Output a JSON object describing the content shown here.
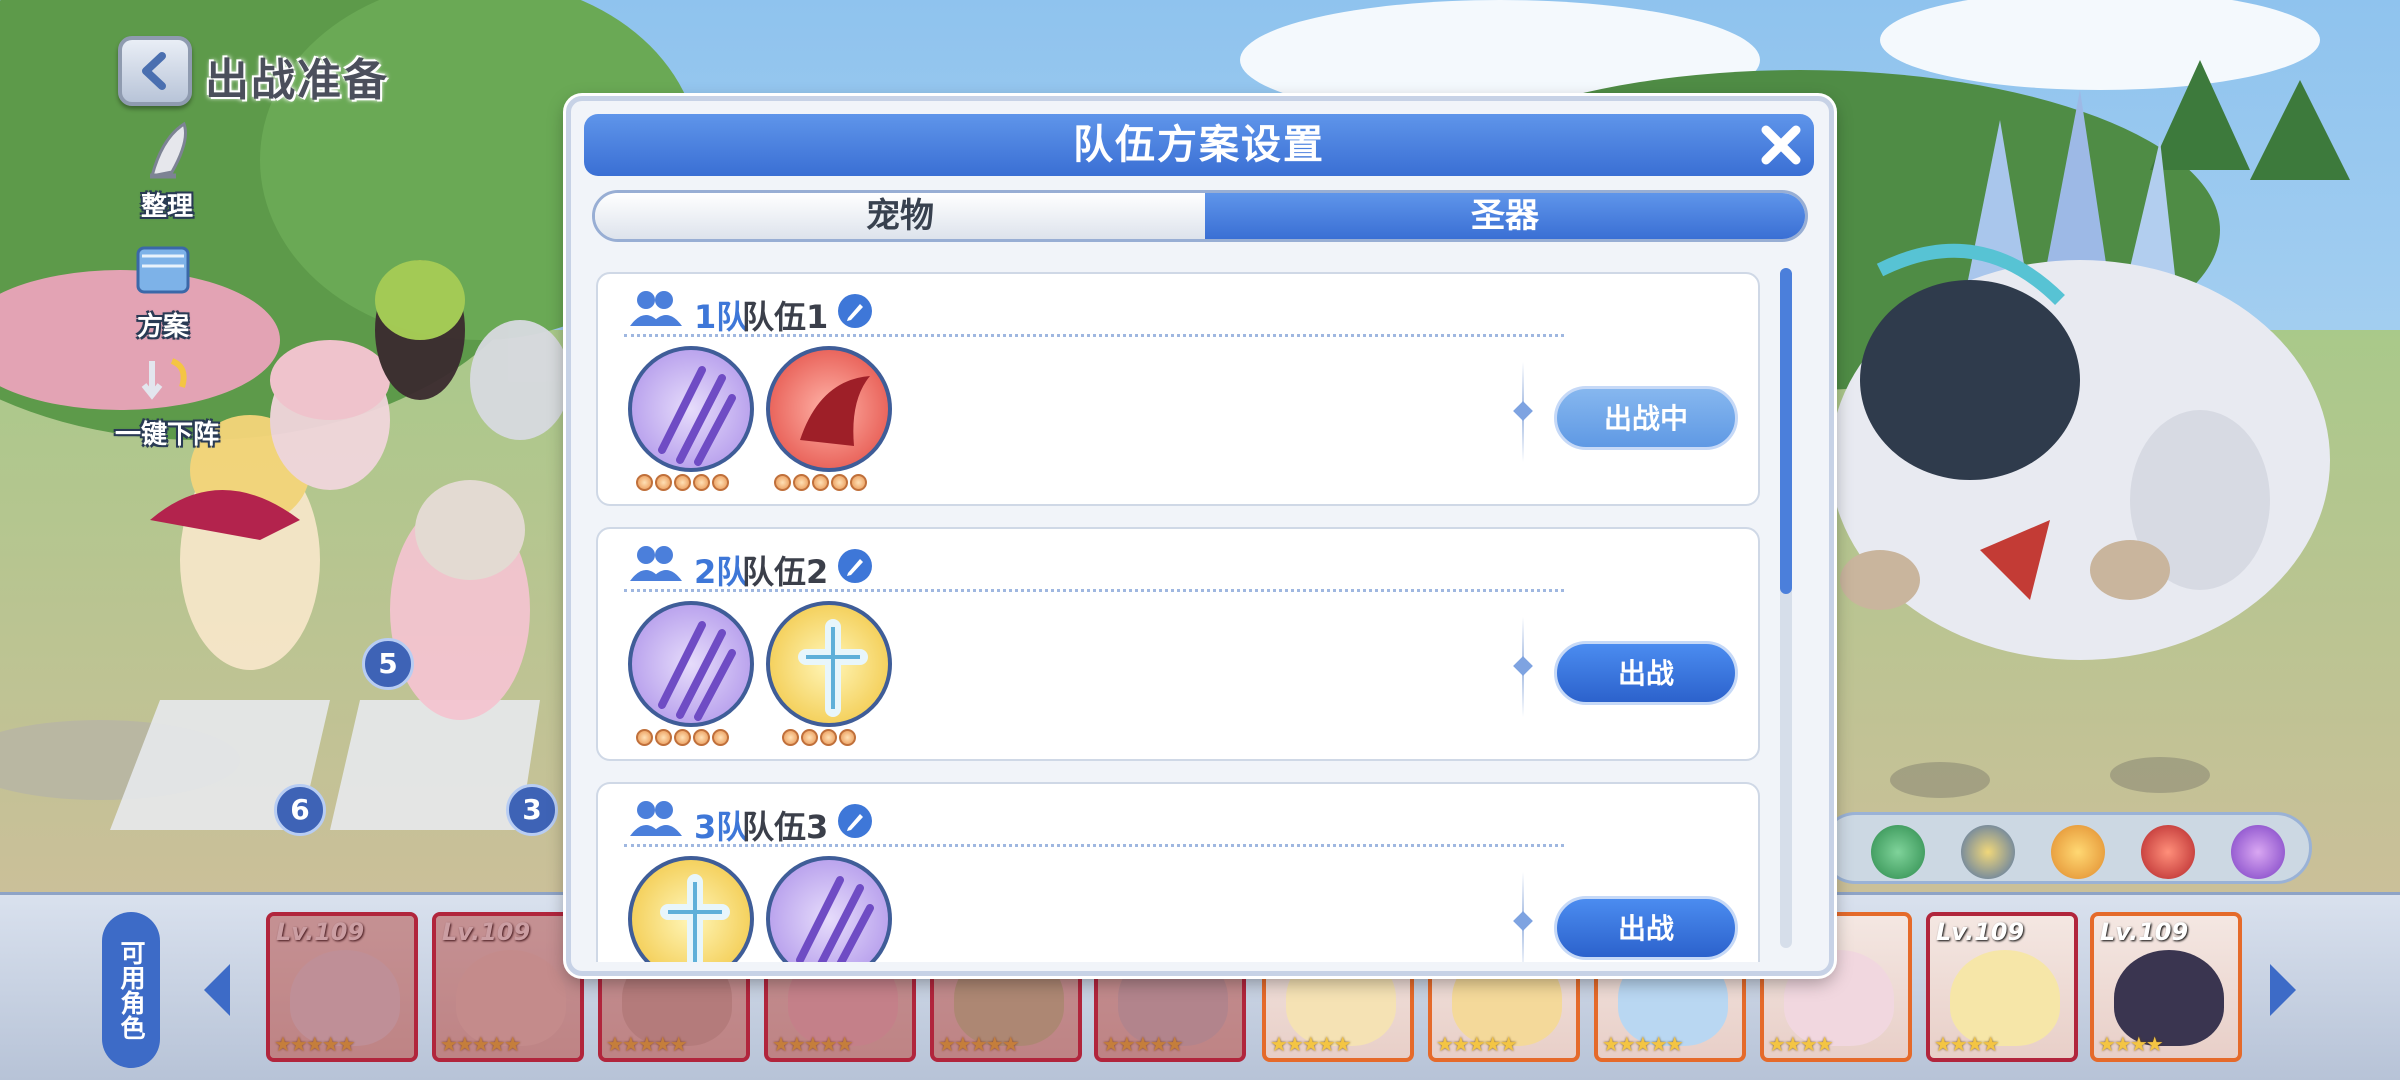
{
  "header": {
    "back_label": "",
    "page_title": "出战准备"
  },
  "side_tools": [
    {
      "label": "整理",
      "icon": "broom-icon"
    },
    {
      "label": "方案",
      "icon": "book-icon"
    },
    {
      "label": "一键下阵",
      "icon": "undeploy-icon"
    }
  ],
  "formation_slots": [
    "5",
    "6",
    "3"
  ],
  "modal": {
    "title": "队伍方案设置",
    "tabs": [
      {
        "label": "宠物",
        "selected": false
      },
      {
        "label": "圣器",
        "selected": true
      }
    ],
    "teams": [
      {
        "number": "1队",
        "name": "队伍1",
        "button": "出战中",
        "button_state": "active",
        "relics": [
          {
            "type": "purple-claw",
            "stars": 5
          },
          {
            "type": "red-wing",
            "stars": 5
          }
        ]
      },
      {
        "number": "2队",
        "name": "队伍2",
        "button": "出战",
        "button_state": "normal",
        "relics": [
          {
            "type": "purple-claw",
            "stars": 5
          },
          {
            "type": "gold-cross",
            "stars": 4
          }
        ]
      },
      {
        "number": "3队",
        "name": "队伍3",
        "button": "出战",
        "button_state": "normal",
        "relics": [
          {
            "type": "gold-cross",
            "stars": 0
          },
          {
            "type": "purple-claw",
            "stars": 0
          }
        ]
      }
    ]
  },
  "bottom_bar": {
    "available_label": "可用角色",
    "cards": [
      {
        "level": "Lv.109",
        "stars": 5,
        "dim": true
      },
      {
        "level": "Lv.109",
        "stars": 5,
        "dim": true
      },
      {
        "level": "",
        "stars": 5,
        "dim": true
      },
      {
        "level": "",
        "stars": 5,
        "dim": true
      },
      {
        "level": "",
        "stars": 5,
        "dim": true
      },
      {
        "level": "",
        "stars": 5,
        "dim": true
      },
      {
        "level": "",
        "stars": 5,
        "dim": false
      },
      {
        "level": "",
        "stars": 5,
        "dim": false
      },
      {
        "level": "",
        "stars": 5,
        "dim": false
      },
      {
        "level": "9",
        "stars": 4,
        "dim": false
      },
      {
        "level": "Lv.109",
        "stars": 4,
        "dim": false
      },
      {
        "level": "Lv.109",
        "stars": 4,
        "dim": false
      }
    ]
  },
  "element_icons": [
    "wind-icon",
    "shield-icon",
    "sun-icon",
    "fire-icon",
    "void-icon"
  ],
  "colors": {
    "accent": "#3a6fd4",
    "active_button": "#6fa6e9",
    "card_border": "#b1253c"
  }
}
